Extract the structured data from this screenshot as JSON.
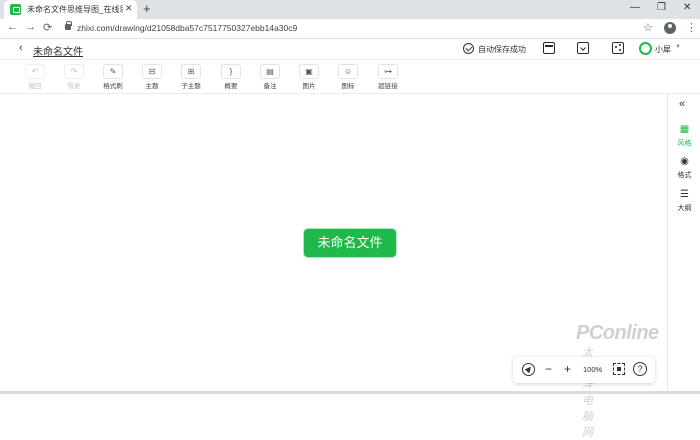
{
  "browser": {
    "tab_title": "未命名文件思维导图_在线思维导",
    "tab_close": "✕",
    "new_tab": "+",
    "url": "zhixi.com/drawing/d21058dba57c7517750327ebb14a30c9",
    "window_controls": {
      "minimize": "—",
      "restore": "❐",
      "close": "✕"
    },
    "nav": {
      "back": "←",
      "forward": "→",
      "reload": "⟳"
    },
    "star": "☆",
    "menu": "⋮"
  },
  "header": {
    "back": "‹",
    "doc_title": "未命名文件",
    "save_status": "自动保存成功",
    "user_name": "小犀",
    "user_caret": "▼"
  },
  "toolbar": {
    "items": [
      {
        "label": "撤回",
        "icon": "↶",
        "disabled": true
      },
      {
        "label": "恢复",
        "icon": "↷",
        "disabled": true
      },
      {
        "label": "格式刷",
        "icon": "✎"
      },
      {
        "label": "主题",
        "icon": "⊟"
      },
      {
        "label": "子主题",
        "icon": "⊞"
      },
      {
        "label": "概要",
        "icon": "}"
      },
      {
        "label": "备注",
        "icon": "▤"
      },
      {
        "label": "图片",
        "icon": "▣"
      },
      {
        "label": "图标",
        "icon": "☺"
      },
      {
        "label": "超链接",
        "icon": "⊶"
      }
    ]
  },
  "canvas": {
    "root_node": "未命名文件"
  },
  "right_panel": {
    "collapse": "«",
    "items": [
      {
        "label": "风格",
        "icon": "▦",
        "active": true
      },
      {
        "label": "格式",
        "icon": "◉",
        "active": false
      },
      {
        "label": "大纲",
        "icon": "☰",
        "active": false
      }
    ]
  },
  "zoom_bar": {
    "minus": "−",
    "plus": "+",
    "zoom": "100%",
    "help": "?"
  },
  "watermark": {
    "brand": "PConline",
    "sub": "太平洋电脑网"
  },
  "colors": {
    "accent": "#1fb84a",
    "tabbar": "#dee1e6"
  }
}
